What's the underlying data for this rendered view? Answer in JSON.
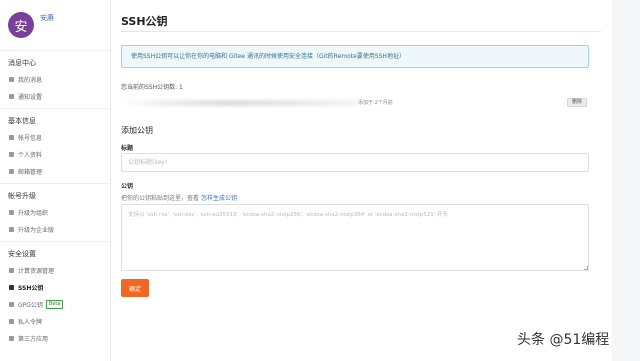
{
  "sidebar": {
    "avatar_text": "安",
    "username": "安赓",
    "groups": [
      {
        "title": "消息中心",
        "items": [
          "我的消息",
          "通知设置"
        ]
      },
      {
        "title": "基本信息",
        "items": [
          "帐号信息",
          "个人资料",
          "邮箱管理"
        ]
      },
      {
        "title": "帐号升级",
        "items": [
          "升级为组织",
          "升级为企业版"
        ]
      },
      {
        "title": "安全设置",
        "items": [
          "计算资源管理",
          "SSH公钥",
          "GPG公钥",
          "私人令牌",
          "第三方应用"
        ]
      }
    ],
    "active_item": "SSH公钥",
    "gpg_badge": "Beta"
  },
  "main": {
    "page_title": "SSH公钥",
    "info_text": "使用SSH公钥可以让你在你的电脑和 Gitee 通讯的时候使用安全连接（Git的Remote要使用SSH地址）",
    "key_count_text": "您当前的SSH公钥数: 1",
    "key_added_text": "添加于 2个月前",
    "delete_label": "删除",
    "add_section_title": "添加公钥",
    "title_label": "标题",
    "title_placeholder": "公钥标题(key)",
    "key_label": "公钥",
    "key_hint": "把你的公钥粘贴到这里，查看",
    "key_hint_link": "怎样生成公钥",
    "key_placeholder": "支持以 'ssh-rsa', 'ssh-dss', 'ssh-ed25519', 'ecdsa-sha2-nistp256', 'ecdsa-sha2-nistp384' or 'ecdsa-sha2-nistp521' 开头",
    "submit_label": "确定"
  },
  "watermark": "头条 @51编程",
  "colors": {
    "accent": "#f26722",
    "avatar": "#7a3f98",
    "link": "#3b6fb6",
    "info_bg": "#eef8fb"
  }
}
